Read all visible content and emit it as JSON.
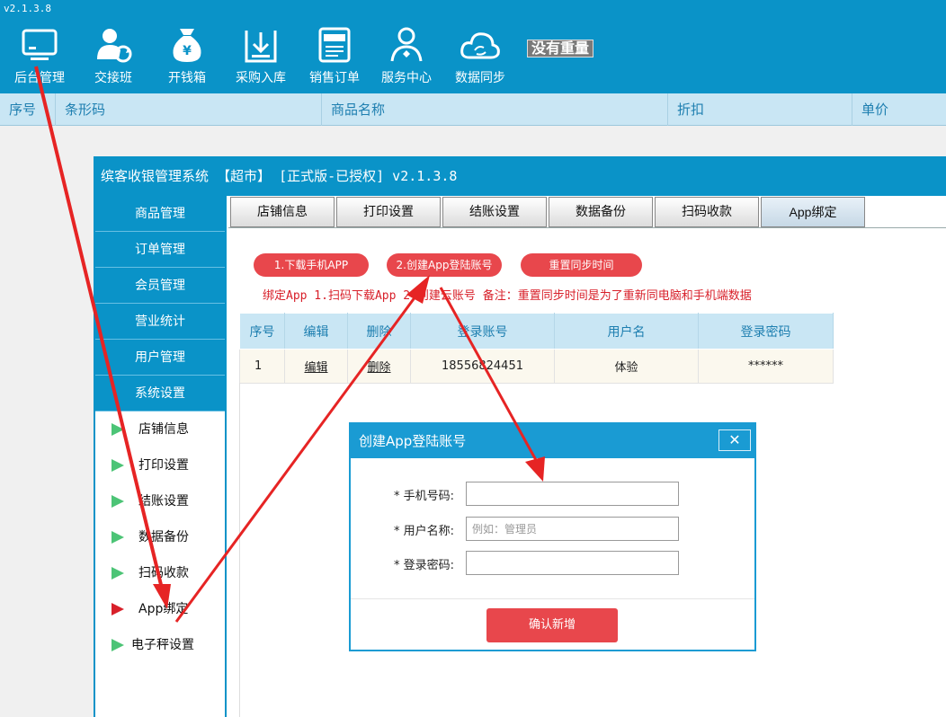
{
  "app": {
    "version": "v2.1.3.8"
  },
  "toolbar": {
    "items": [
      {
        "label": "后台管理",
        "icon": "monitor-icon"
      },
      {
        "label": "交接班",
        "icon": "user-sync-icon"
      },
      {
        "label": "开钱箱",
        "icon": "money-bag-icon"
      },
      {
        "label": "采购入库",
        "icon": "download-box-icon"
      },
      {
        "label": "销售订单",
        "icon": "order-list-icon"
      },
      {
        "label": "服务中心",
        "icon": "service-person-icon"
      },
      {
        "label": "数据同步",
        "icon": "cloud-sync-icon"
      }
    ],
    "weight_display": "没有重量"
  },
  "product_table": {
    "columns": [
      "序号",
      "条形码",
      "商品名称",
      "折扣",
      "单价"
    ]
  },
  "sub_window": {
    "title": "缤客收银管理系统 【超市】 [正式版-已授权] v2.1.3.8",
    "sidebar": {
      "menu": [
        "商品管理",
        "订单管理",
        "会员管理",
        "营业统计",
        "用户管理",
        "系统设置"
      ],
      "sub_items": [
        "店铺信息",
        "打印设置",
        "结账设置",
        "数据备份",
        "扫码收款",
        "App绑定",
        "电子秤设置"
      ],
      "active_sub": "App绑定"
    },
    "tabs": [
      "店铺信息",
      "打印设置",
      "结账设置",
      "数据备份",
      "扫码收款",
      "App绑定"
    ],
    "active_tab": "App绑定",
    "buttons": {
      "download_app": "1.下载手机APP",
      "create_account": "2.创建App登陆账号",
      "reset_sync": "重置同步时间"
    },
    "note": {
      "steps": "绑定App 1.扫码下载App 2.创建云账号",
      "remark": "备注：重置同步时间是为了重新同电脑和手机端数据"
    },
    "accounts_table": {
      "columns": [
        "序号",
        "编辑",
        "删除",
        "登录账号",
        "用户名",
        "登录密码"
      ],
      "rows": [
        {
          "index": "1",
          "edit": "编辑",
          "delete": "删除",
          "account": "18556824451",
          "username": "体验",
          "password": "******"
        }
      ]
    }
  },
  "dialog": {
    "title": "创建App登陆账号",
    "close": "✕",
    "fields": {
      "phone_label": "* 手机号码:",
      "phone_value": "",
      "username_label": "* 用户名称:",
      "username_placeholder": "例如：管理员",
      "password_label": "* 登录密码:",
      "password_value": ""
    },
    "confirm": "确认新增"
  },
  "colors": {
    "primary": "#0a93c8",
    "header_bg": "#c9e6f4",
    "danger": "#e8474c",
    "annotation": "#e62424",
    "active_marker": "#d8202a",
    "inactive_marker": "#4cc476"
  }
}
